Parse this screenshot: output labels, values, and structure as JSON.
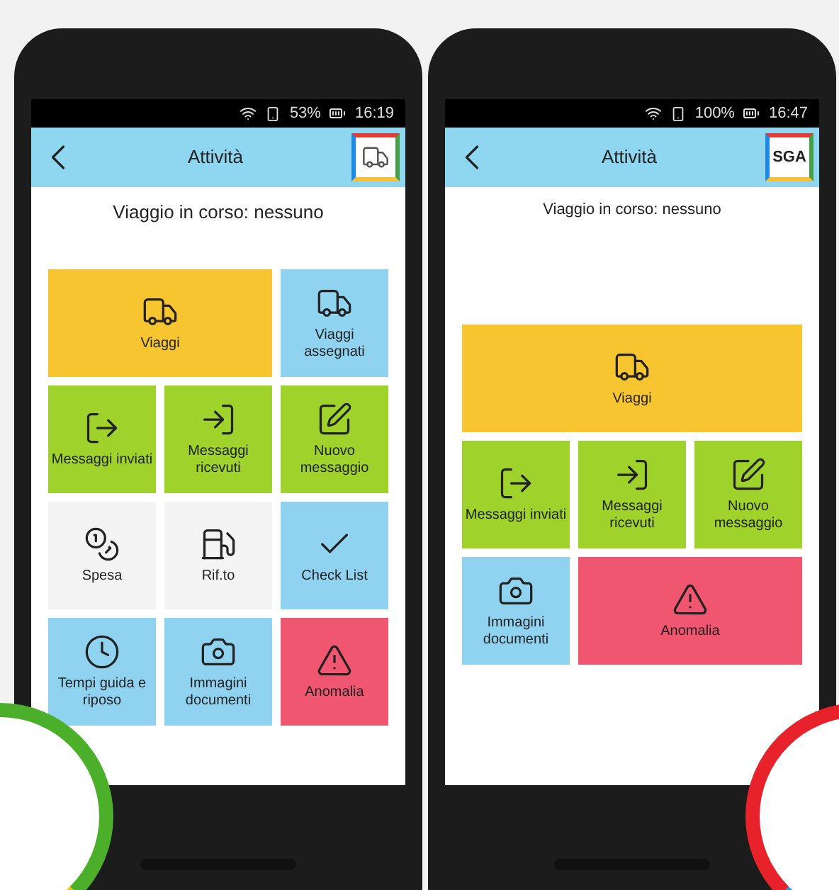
{
  "phones": [
    {
      "status_bar": {
        "battery": "53%",
        "time": "16:19"
      },
      "header": {
        "title": "Attività",
        "logo": {
          "kind": "truck"
        }
      },
      "trip_status": "Viaggio in corso: nessuno",
      "tiles": [
        {
          "label": "Viaggi",
          "kind": "truck",
          "color": "#f7c52f"
        },
        {
          "label": "Viaggi assegnati",
          "kind": "truck",
          "color": "#8fd3f0"
        },
        {
          "label": "Messaggi inviati",
          "kind": "exit",
          "color": "#9fd32c"
        },
        {
          "label": "Messaggi ricevuti",
          "kind": "enter",
          "color": "#9fd32c"
        },
        {
          "label": "Nuovo messaggio",
          "kind": "edit",
          "color": "#9fd32c"
        },
        {
          "label": "Spesa",
          "kind": "coins",
          "color": "#f4f4f4"
        },
        {
          "label": "Rif.to",
          "kind": "fuel",
          "color": "#f4f4f4"
        },
        {
          "label": "Check List",
          "kind": "check",
          "color": "#8fd3f0"
        },
        {
          "label": "Tempi guida e riposo",
          "kind": "clock",
          "color": "#8fd3f0"
        },
        {
          "label": "Immagini documenti",
          "kind": "camera",
          "color": "#8fd3f0"
        },
        {
          "label": "Anomalia",
          "kind": "warning",
          "color": "#f0566f"
        }
      ]
    },
    {
      "status_bar": {
        "battery": "100%",
        "time": "16:47"
      },
      "header": {
        "title": "Attività",
        "logo": {
          "kind": "text",
          "text": "SGA"
        }
      },
      "trip_status": "Viaggio in corso: nessuno",
      "tiles": [
        {
          "label": "Viaggi",
          "kind": "truck",
          "color": "#f7c52f"
        },
        {
          "label": "Messaggi inviati",
          "kind": "exit",
          "color": "#9fd32c"
        },
        {
          "label": "Messaggi ricevuti",
          "kind": "enter",
          "color": "#9fd32c"
        },
        {
          "label": "Nuovo messaggio",
          "kind": "edit",
          "color": "#9fd32c"
        },
        {
          "label": "Immagini documenti",
          "kind": "camera",
          "color": "#8fd3f0"
        },
        {
          "label": "Anomalia",
          "kind": "warning",
          "color": "#f0566f"
        }
      ]
    }
  ]
}
